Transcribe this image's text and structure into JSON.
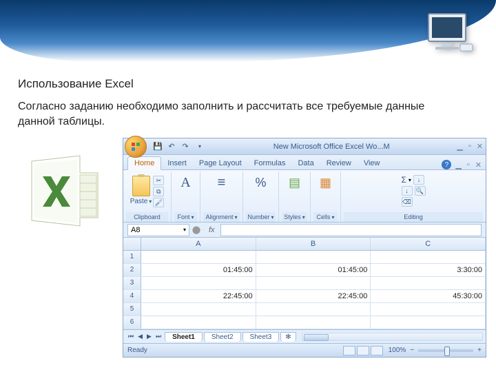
{
  "page": {
    "title": "Использование Excel",
    "subtitle": "Согласно заданию необходимо заполнить и рассчитать все требуемые данные данной таблицы."
  },
  "window": {
    "title": "New Microsoft Office Excel Wo...M"
  },
  "tabs": {
    "home": "Home",
    "insert": "Insert",
    "pagelayout": "Page Layout",
    "formulas": "Formulas",
    "data": "Data",
    "review": "Review",
    "view": "View"
  },
  "groups": {
    "paste_label": "Paste",
    "clipboard": "Clipboard",
    "font": "Font",
    "alignment": "Alignment",
    "number": "Number",
    "styles": "Styles",
    "cells": "Cells",
    "editing": "Editing"
  },
  "namebox": "A8",
  "fx": "fx",
  "columns": [
    "A",
    "B",
    "C"
  ],
  "rows": [
    {
      "n": "1",
      "cells": [
        "",
        "",
        ""
      ]
    },
    {
      "n": "2",
      "cells": [
        "01:45:00",
        "01:45:00",
        "3:30:00"
      ]
    },
    {
      "n": "3",
      "cells": [
        "",
        "",
        ""
      ]
    },
    {
      "n": "4",
      "cells": [
        "22:45:00",
        "22:45:00",
        "45:30:00"
      ]
    },
    {
      "n": "5",
      "cells": [
        "",
        "",
        ""
      ]
    },
    {
      "n": "6",
      "cells": [
        "",
        "",
        ""
      ]
    }
  ],
  "sheets": {
    "s1": "Sheet1",
    "s2": "Sheet2",
    "s3": "Sheet3"
  },
  "status": {
    "ready": "Ready",
    "zoom": "100%"
  },
  "icons": {
    "sigma": "Σ",
    "percent": "%",
    "bold": "A",
    "sort": "↓",
    "search": "🔍",
    "cells": "▦",
    "styles": "▤",
    "align": "≡",
    "minus": "−",
    "plus": "+"
  }
}
